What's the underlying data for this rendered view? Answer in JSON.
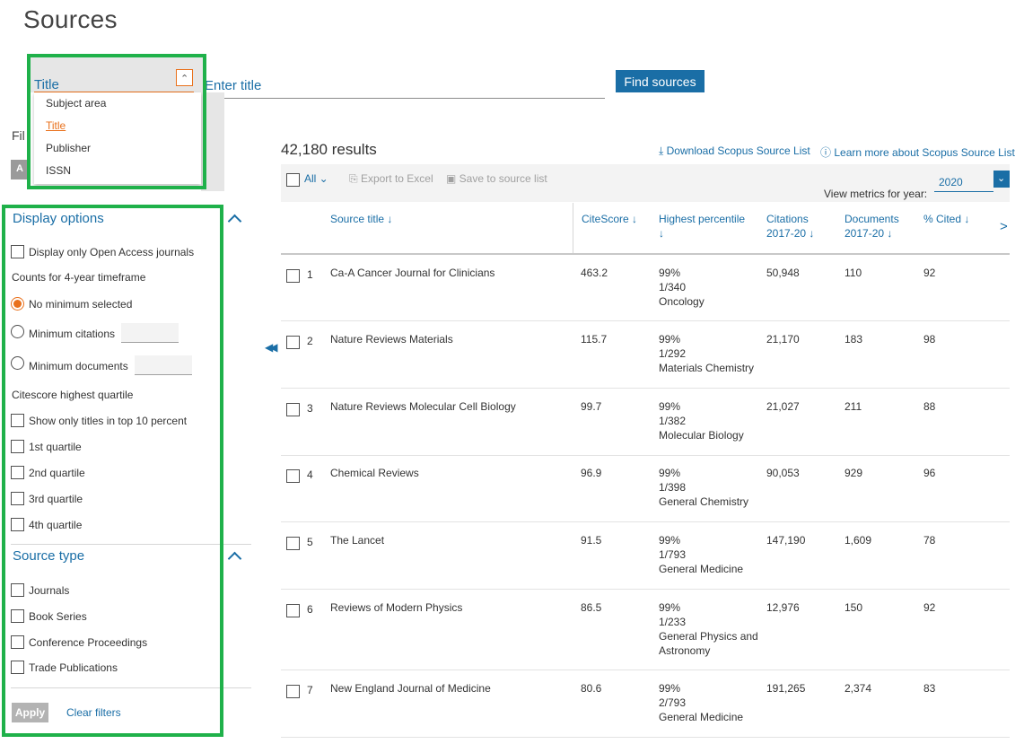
{
  "page_title": "Sources",
  "search": {
    "type_label": "Title",
    "placeholder": "Enter title",
    "button_label": "Find sources",
    "dropdown_options": [
      "Subject area",
      "Title",
      "Publisher",
      "ISSN"
    ],
    "selected_option": "Title"
  },
  "filter_label_clip": "Fil",
  "filter_chip": "A",
  "display_options": {
    "title": "Display options",
    "open_access": "Display only Open Access journals",
    "counts_label": "Counts for 4-year timeframe",
    "no_minimum": "No minimum selected",
    "min_citations": "Minimum citations",
    "min_documents": "Minimum documents",
    "quartile_label": "Citescore highest quartile",
    "top10": "Show only titles in top 10 percent",
    "q1": "1st quartile",
    "q2": "2nd quartile",
    "q3": "3rd quartile",
    "q4": "4th quartile"
  },
  "source_type": {
    "title": "Source type",
    "journals": "Journals",
    "book_series": "Book Series",
    "conference": "Conference Proceedings",
    "trade": "Trade Publications"
  },
  "actions": {
    "apply": "Apply",
    "clear": "Clear filters"
  },
  "results": {
    "count": "42,180 results",
    "download": "Download Scopus Source List",
    "learn_more": "Learn more about Scopus Source List",
    "all": "All",
    "export": "Export to Excel",
    "save": "Save to source list",
    "year_label": "View metrics for year:",
    "year": "2020"
  },
  "columns": {
    "title": "Source title ↓",
    "citescore": "CiteScore ↓",
    "percentile_1": "Highest percentile",
    "percentile_2": "↓",
    "citations_1": "Citations",
    "citations_2": "2017-20 ↓",
    "documents_1": "Documents",
    "documents_2": "2017-20 ↓",
    "cited": "% Cited ↓"
  },
  "rows": [
    {
      "num": "1",
      "title": "Ca-A Cancer Journal for Clinicians",
      "citescore": "463.2",
      "pct": "99%",
      "rank": "1/340",
      "area": "Oncology",
      "area2": "",
      "citations": "50,948",
      "documents": "110",
      "cited": "92"
    },
    {
      "num": "2",
      "title": "Nature Reviews Materials",
      "citescore": "115.7",
      "pct": "99%",
      "rank": "1/292",
      "area": "Materials Chemistry",
      "area2": "",
      "citations": "21,170",
      "documents": "183",
      "cited": "98"
    },
    {
      "num": "3",
      "title": "Nature Reviews Molecular Cell Biology",
      "citescore": "99.7",
      "pct": "99%",
      "rank": "1/382",
      "area": "Molecular Biology",
      "area2": "",
      "citations": "21,027",
      "documents": "211",
      "cited": "88"
    },
    {
      "num": "4",
      "title": "Chemical Reviews",
      "citescore": "96.9",
      "pct": "99%",
      "rank": "1/398",
      "area": "General Chemistry",
      "area2": "",
      "citations": "90,053",
      "documents": "929",
      "cited": "96"
    },
    {
      "num": "5",
      "title": "The Lancet",
      "citescore": "91.5",
      "pct": "99%",
      "rank": "1/793",
      "area": "General Medicine",
      "area2": "",
      "citations": "147,190",
      "documents": "1,609",
      "cited": "78"
    },
    {
      "num": "6",
      "title": "Reviews of Modern Physics",
      "citescore": "86.5",
      "pct": "99%",
      "rank": "1/233",
      "area": "General Physics and",
      "area2": "Astronomy",
      "citations": "12,976",
      "documents": "150",
      "cited": "92"
    },
    {
      "num": "7",
      "title": "New England Journal of Medicine",
      "citescore": "80.6",
      "pct": "99%",
      "rank": "2/793",
      "area": "General Medicine",
      "area2": "",
      "citations": "191,265",
      "documents": "2,374",
      "cited": "83"
    }
  ]
}
